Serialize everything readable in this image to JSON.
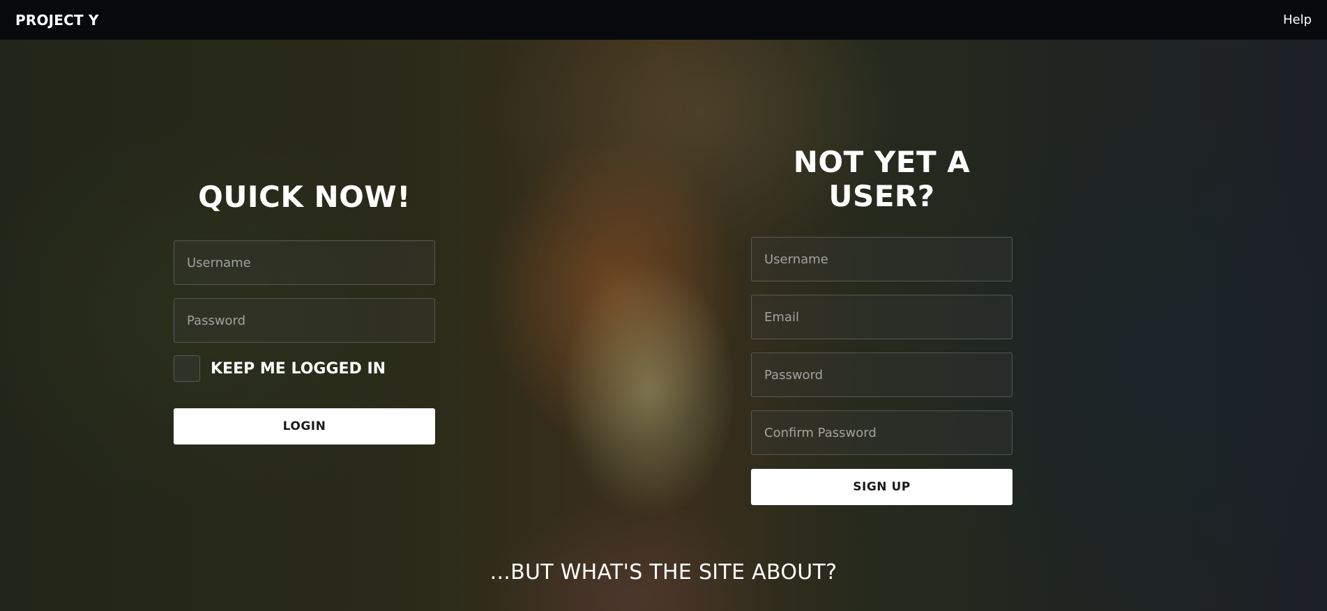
{
  "navbar": {
    "brand": "PROJECT Y",
    "help_label": "Help"
  },
  "login": {
    "title": "QUICK NOW!",
    "username_placeholder": "Username",
    "password_placeholder": "Password",
    "keep_logged_in_label": "KEEP ME LOGGED IN",
    "submit_label": "LOGIN"
  },
  "signup": {
    "title": "NOT YET A USER?",
    "username_placeholder": "Username",
    "email_placeholder": "Email",
    "password_placeholder": "Password",
    "confirm_password_placeholder": "Confirm Password",
    "submit_label": "SIGN UP"
  },
  "footer": {
    "about_label": "...BUT WHAT'S THE SITE ABOUT?"
  },
  "colors": {
    "navbar_bg": "#07090d",
    "button_bg": "#ffffff",
    "button_text": "#1a1a1a",
    "text": "#ffffff"
  }
}
